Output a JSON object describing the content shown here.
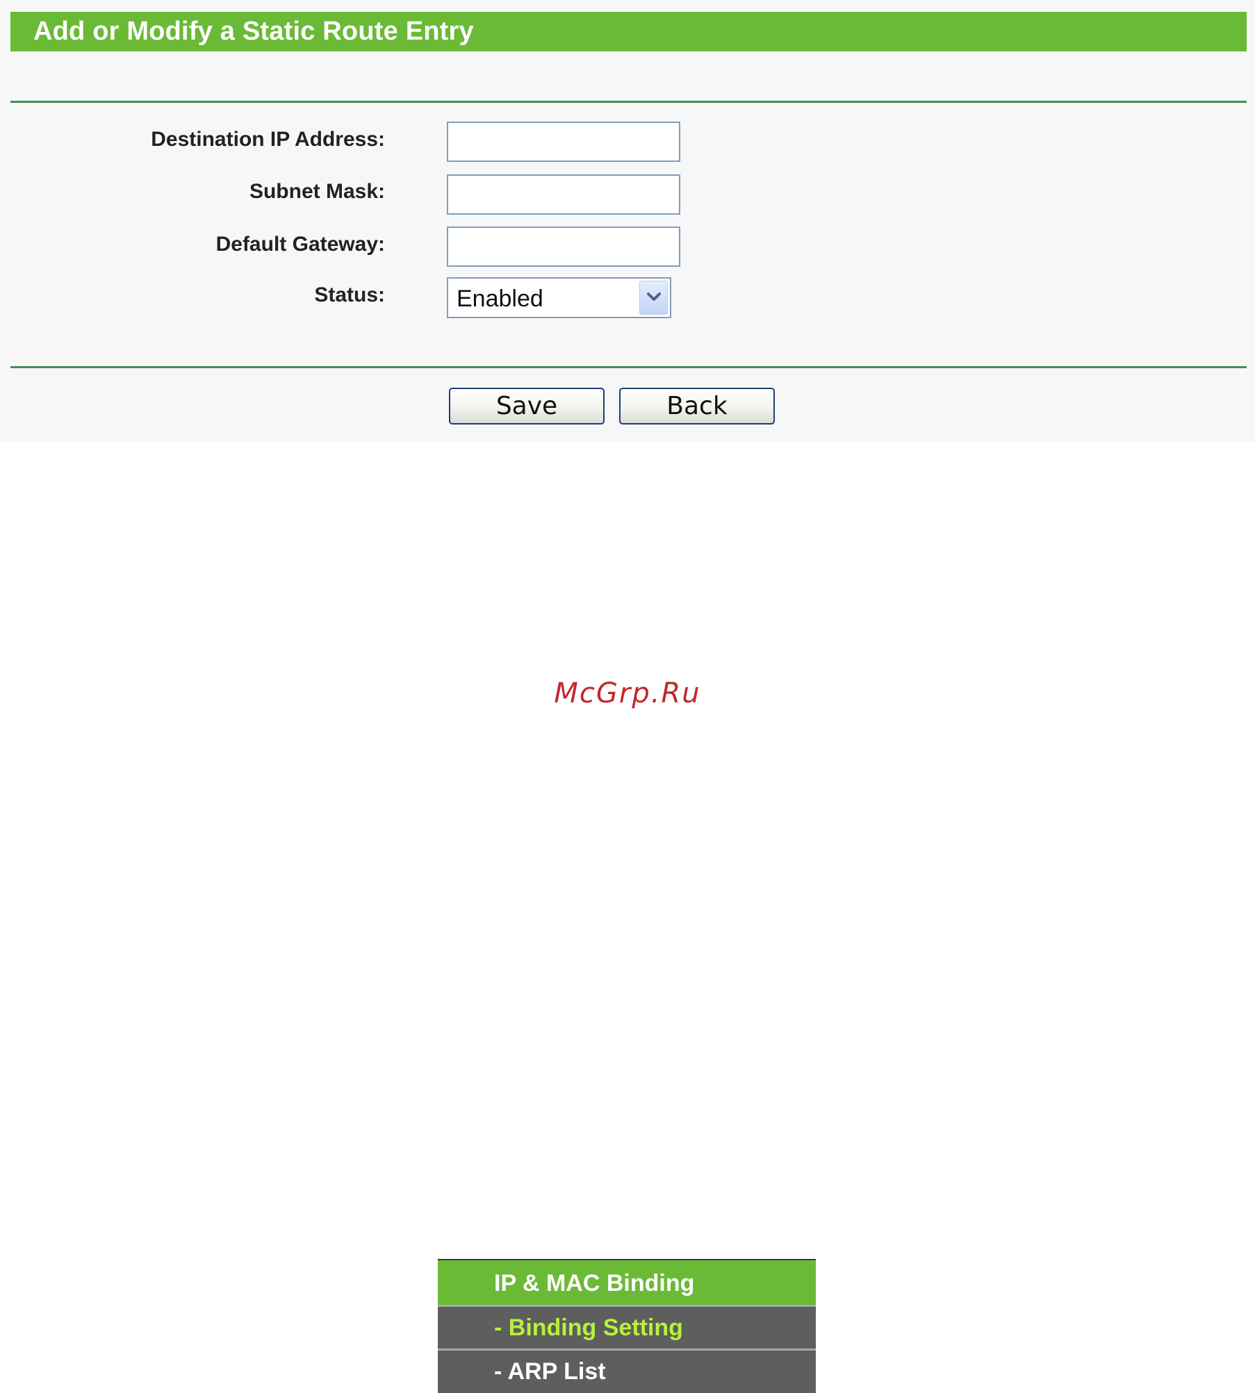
{
  "form": {
    "title": "Add or Modify a Static Route Entry",
    "fields": {
      "destination_ip": {
        "label": "Destination IP Address:",
        "value": ""
      },
      "subnet_mask": {
        "label": "Subnet Mask:",
        "value": ""
      },
      "default_gateway": {
        "label": "Default Gateway:",
        "value": ""
      },
      "status": {
        "label": "Status:",
        "value": "Enabled"
      }
    },
    "buttons": {
      "save_label": "Save",
      "back_label": "Back"
    }
  },
  "watermark": "McGrp.Ru",
  "menu": {
    "header": "IP & MAC Binding",
    "items": [
      {
        "label": "- Binding Setting",
        "active": true
      },
      {
        "label": "- ARP List",
        "active": false
      }
    ]
  },
  "colors": {
    "brand_green": "#6aba36",
    "rule_green": "#3f8e5a",
    "menu_gray": "#5e5e5e",
    "menu_active_text": "#b6f23a",
    "watermark_red": "#c0282e"
  },
  "icons": {
    "select_arrow": "chevron-down-icon"
  }
}
